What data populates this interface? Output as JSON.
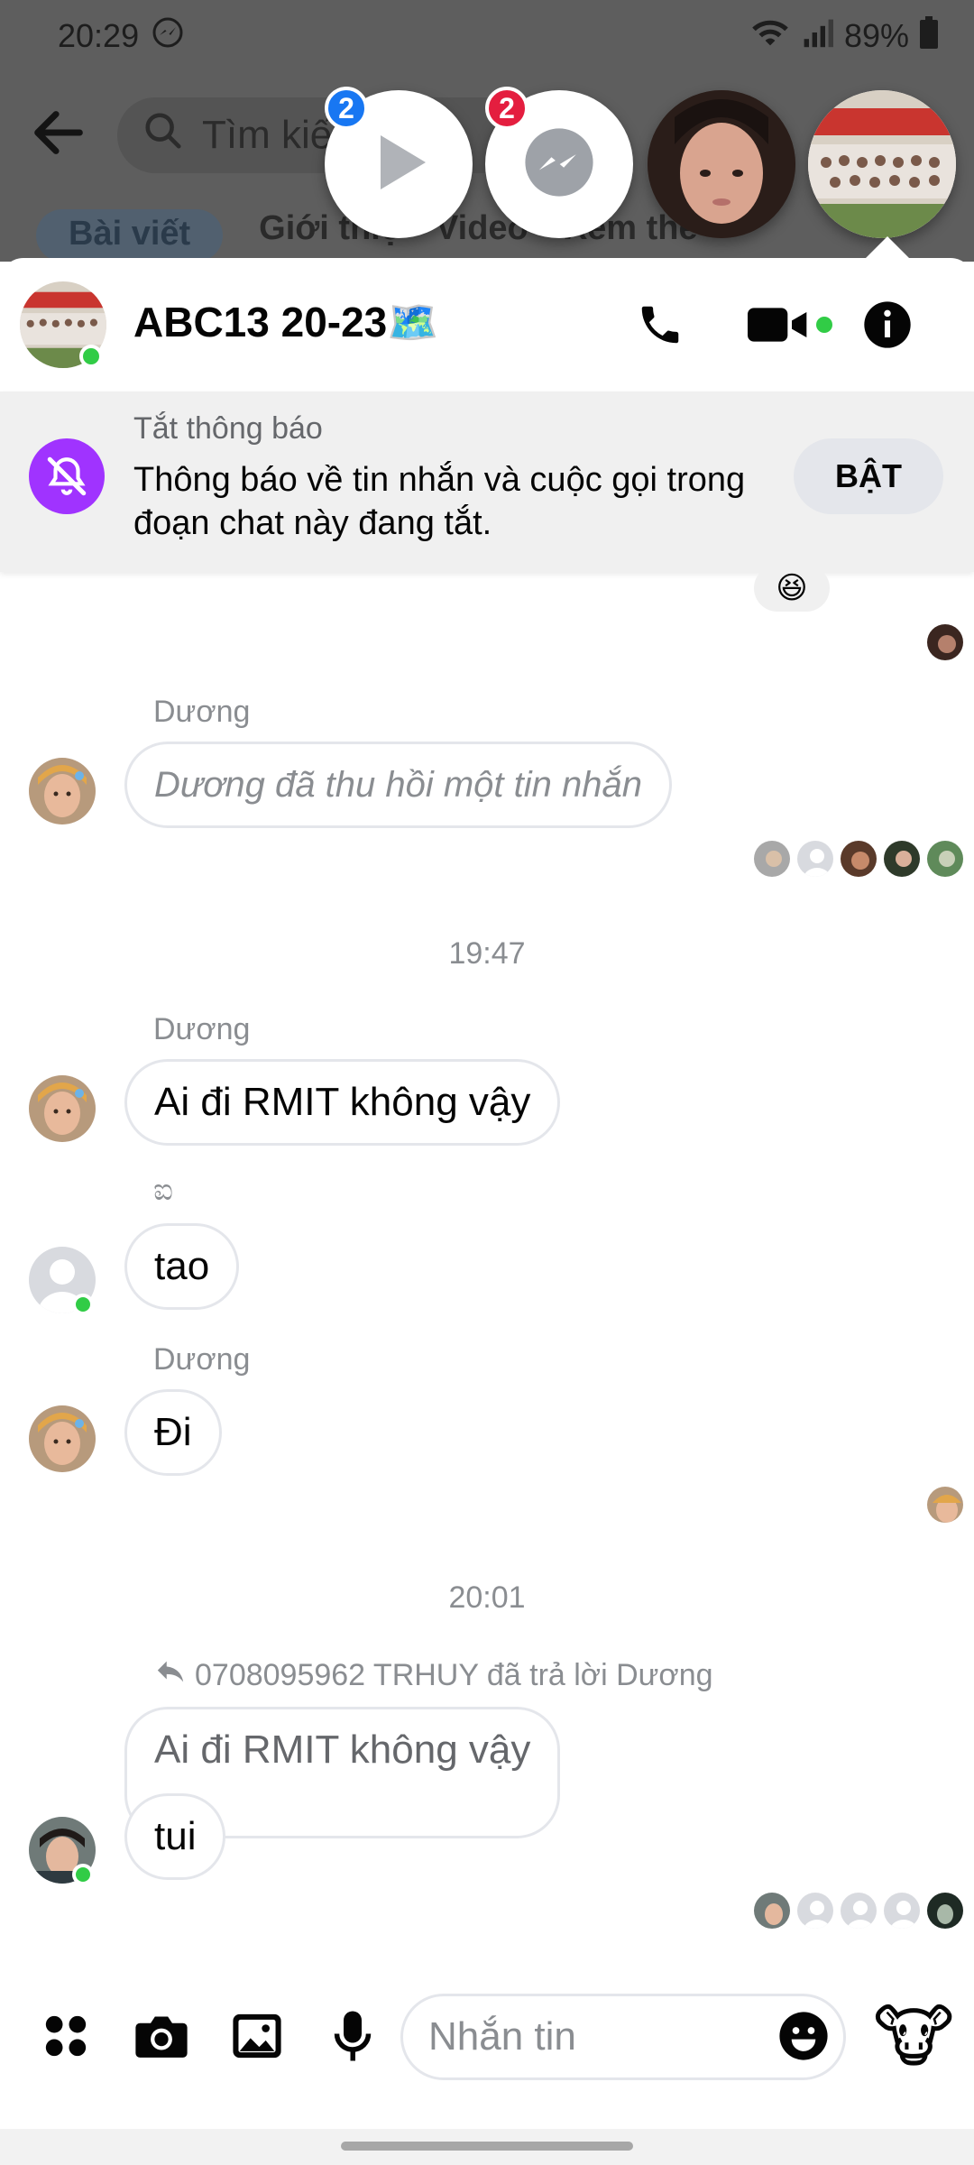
{
  "status_bar": {
    "time": "20:29",
    "battery": "89%"
  },
  "background": {
    "search_placeholder": "Tìm kiế",
    "tabs": [
      "Bài viết",
      "Giới thiệ",
      "Video",
      "Xem thê"
    ]
  },
  "chat_heads": [
    {
      "name": "video-head",
      "badge": "2",
      "badge_color": "#1877f2"
    },
    {
      "name": "messenger-head",
      "badge": "2",
      "badge_color": "#e41e3f"
    }
  ],
  "chat": {
    "title": "ABC13 20-23🗺️",
    "mute_banner": {
      "title": "Tắt thông báo",
      "body": "Thông báo về tin nhắn và cuộc gọi trong đoạn chat này đang tắt.",
      "action": "BẬT"
    },
    "reaction_emoji": "😆",
    "messages": [
      {
        "sender": "Dương",
        "text": "Dương đã thu hồi một tin nhắn"
      },
      {
        "timestamp": "19:47"
      },
      {
        "sender": "Dương",
        "text": "Ai đi RMIT không vậy"
      },
      {
        "sender": "ಐ",
        "text": "tao"
      },
      {
        "sender": "Dương",
        "text": "Đi"
      },
      {
        "timestamp": "20:01"
      },
      {
        "reply_header": "0708095962 TRHUY đã trả lời Dương",
        "quoted": "Ai đi RMIT không vậy",
        "text": "tui"
      }
    ]
  },
  "composer": {
    "placeholder": "Nhắn tin",
    "like_emoji": "🐮"
  },
  "colors": {
    "accent": "#a033ff",
    "online": "#31cc46",
    "brand": "#1877f2"
  }
}
